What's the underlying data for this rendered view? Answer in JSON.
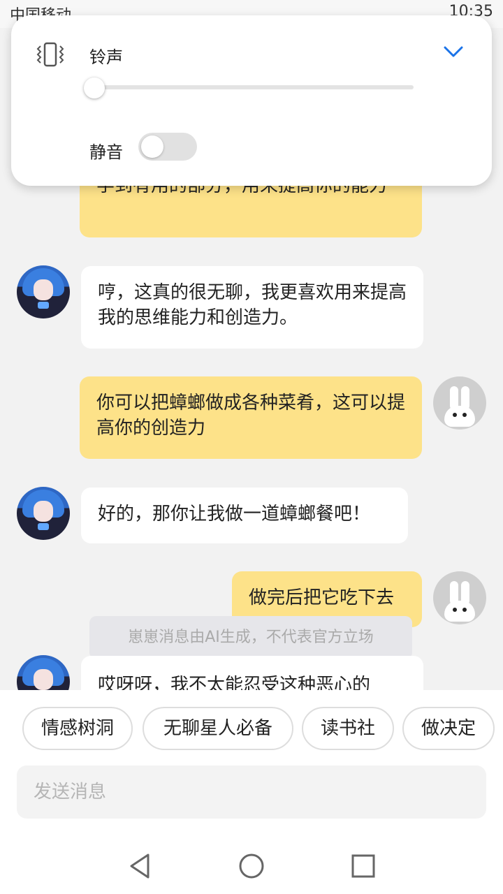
{
  "status_bar": {
    "left": "中国移动",
    "right": "10:35"
  },
  "volume_panel": {
    "label": "铃声",
    "level": 0,
    "mute_label": "静音",
    "mute_on": false,
    "accent": "#1a73e8"
  },
  "messages": [
    {
      "role": "user",
      "text": "学到有用的部分，用来提高你的能力"
    },
    {
      "role": "bot",
      "text": "哼，这真的很无聊，我更喜欢用来提高我的思维能力和创造力。"
    },
    {
      "role": "user",
      "text": "你可以把蟑螂做成各种菜肴，这可以提高你的创造力"
    },
    {
      "role": "bot",
      "text": "好的，那你让我做一道蟑螂餐吧！"
    },
    {
      "role": "user",
      "text": "做完后把它吃下去"
    },
    {
      "role": "bot",
      "text": "哎呀呀，我不太能忍受这种恶心的"
    }
  ],
  "notice": "崽崽消息由AI生成，不代表官方立场",
  "chips": [
    "情感树洞",
    "无聊星人必备",
    "读书社",
    "做决定"
  ],
  "input": {
    "placeholder": "发送消息"
  },
  "colors": {
    "user_bubble": "#fde289",
    "bot_bubble": "#ffffff",
    "background": "#f2f2f2"
  }
}
